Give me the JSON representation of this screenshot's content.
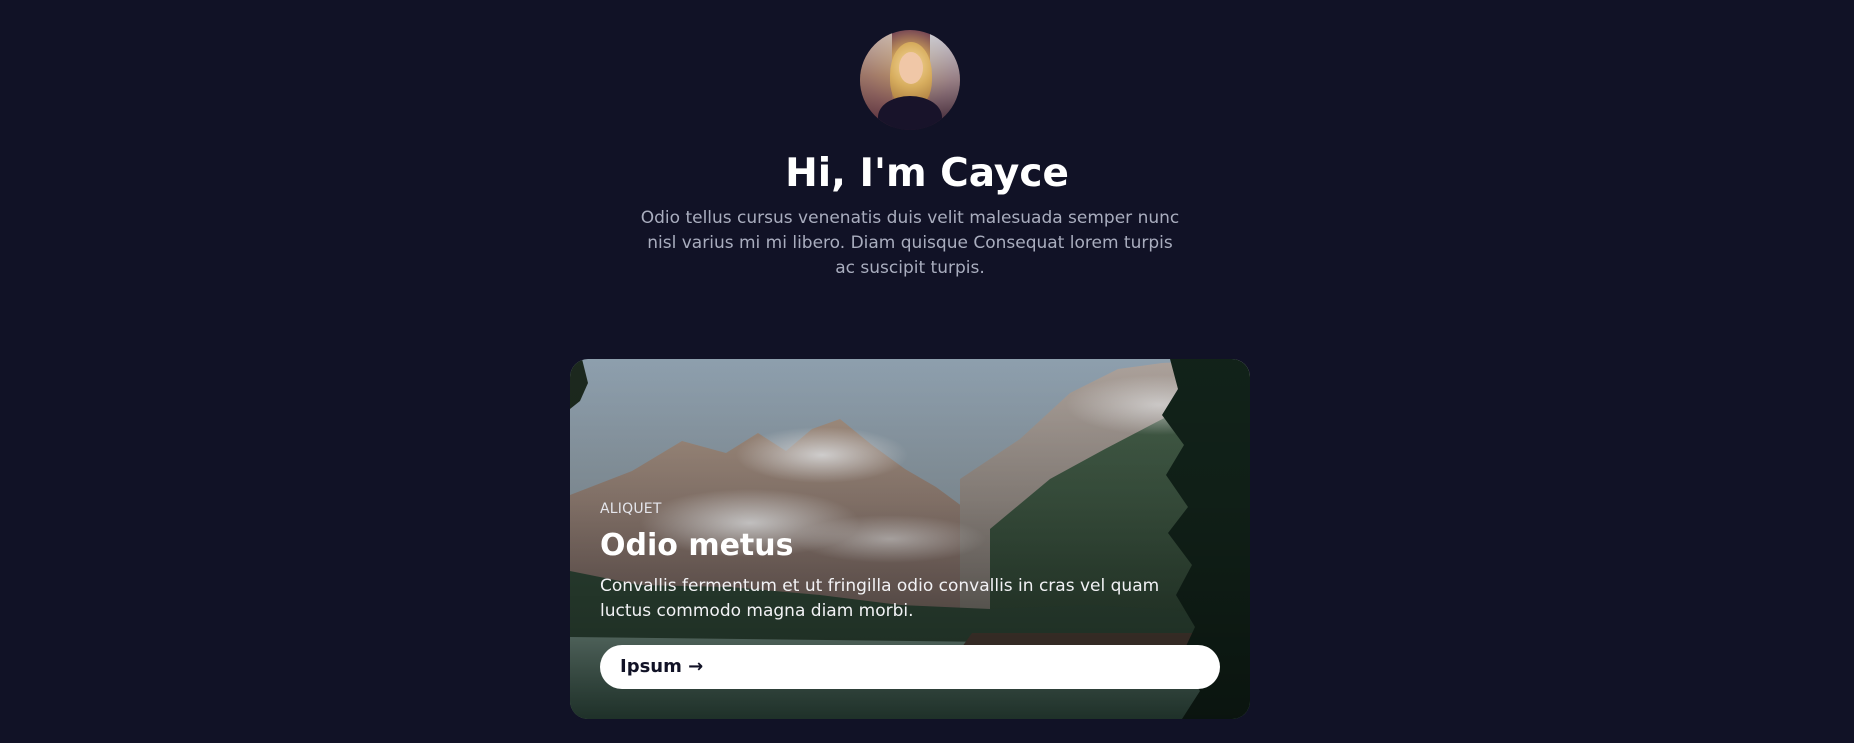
{
  "profile": {
    "avatar_alt": "avatar",
    "title": "Hi, I'm Cayce",
    "description": "Odio tellus cursus venenatis duis velit malesuada semper nunc nisl varius mi mi libero. Diam quisque Consequat lorem turpis ac suscipit turpis."
  },
  "card": {
    "eyebrow": "ALIQUET",
    "title": "Odio metus",
    "description": "Convallis fermentum et ut fringilla odio convallis in cras vel quam luctus commodo magna diam morbi.",
    "button": "Ipsum →"
  },
  "colors": {
    "background": "#111226",
    "heading": "#ffffff",
    "body_text": "#a9adbe",
    "button_bg": "#ffffff",
    "button_text": "#111226"
  }
}
